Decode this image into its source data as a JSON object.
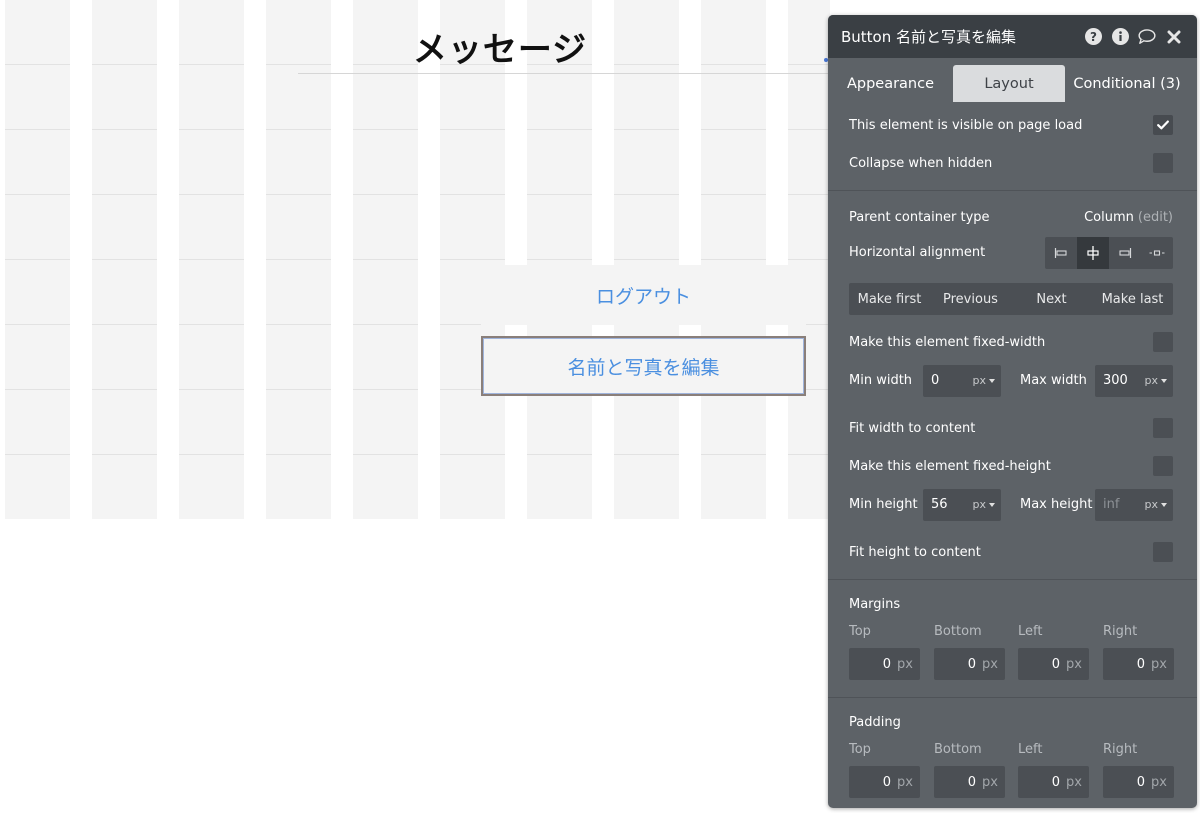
{
  "canvas": {
    "title": "メッセージ",
    "buttons": {
      "logout": "ログアウト",
      "edit_profile": "名前と写真を編集"
    }
  },
  "panel": {
    "title": "Button 名前と写真を編集",
    "header_icons": [
      "help-icon",
      "info-icon",
      "comment-icon",
      "close-icon"
    ],
    "tabs": [
      {
        "label": "Appearance",
        "active": false
      },
      {
        "label": "Layout",
        "active": true
      },
      {
        "label": "Conditional (3)",
        "active": false
      }
    ],
    "visibility": {
      "visible_on_load_label": "This element is visible on page load",
      "visible_on_load": true,
      "collapse_label": "Collapse when hidden",
      "collapse": false
    },
    "container": {
      "parent_type_label": "Parent container type",
      "parent_type_value": "Column",
      "parent_type_edit": "(edit)",
      "halign_label": "Horizontal alignment",
      "halign_options": [
        "align-left-icon",
        "align-center-icon",
        "align-right-icon",
        "align-distribute-icon"
      ],
      "halign_selected": 1
    },
    "order_buttons": [
      "Make first",
      "Previous",
      "Next",
      "Make last"
    ],
    "width": {
      "fixed_width_label": "Make this element fixed-width",
      "fixed_width": false,
      "min_label": "Min width",
      "min_value": "0",
      "min_unit": "px",
      "max_label": "Max width",
      "max_value": "300",
      "max_unit": "px",
      "fit_label": "Fit width to content",
      "fit": false
    },
    "height": {
      "fixed_height_label": "Make this element fixed-height",
      "fixed_height": false,
      "min_label": "Min height",
      "min_value": "56",
      "min_unit": "px",
      "max_label": "Max height",
      "max_placeholder": "inf",
      "max_unit": "px",
      "fit_label": "Fit height to content",
      "fit": false
    },
    "margins": {
      "title": "Margins",
      "fields": [
        {
          "label": "Top",
          "value": "0",
          "unit": "px"
        },
        {
          "label": "Bottom",
          "value": "0",
          "unit": "px"
        },
        {
          "label": "Left",
          "value": "0",
          "unit": "px"
        },
        {
          "label": "Right",
          "value": "0",
          "unit": "px"
        }
      ]
    },
    "padding": {
      "title": "Padding",
      "fields": [
        {
          "label": "Top",
          "value": "0",
          "unit": "px"
        },
        {
          "label": "Bottom",
          "value": "0",
          "unit": "px"
        },
        {
          "label": "Left",
          "value": "0",
          "unit": "px"
        },
        {
          "label": "Right",
          "value": "0",
          "unit": "px"
        }
      ]
    },
    "colors": {
      "panel_bg": "#5d6267",
      "header_bg": "#3a3f44",
      "active_tab_bg": "#dadcde",
      "canvas_button_text": "#4a8fe0"
    }
  }
}
